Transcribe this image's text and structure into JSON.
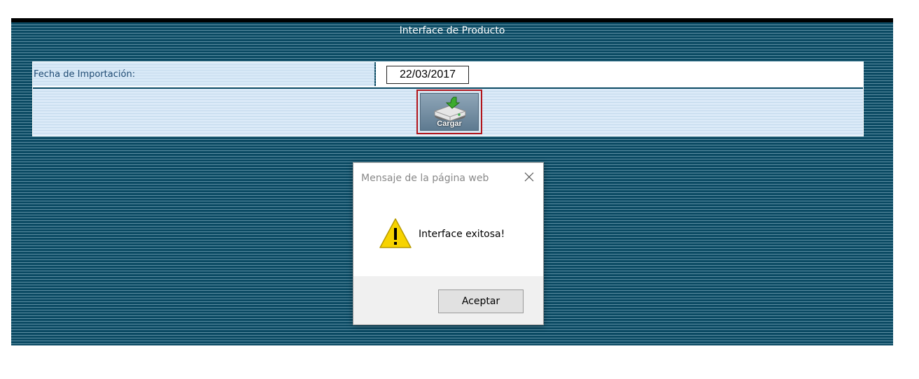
{
  "page": {
    "title": "Interface de Producto"
  },
  "form": {
    "date_label": "Fecha de Importación:",
    "date_value": "22/03/2017",
    "load_button_label": "Cargar",
    "load_button_icon": "disk-download-icon"
  },
  "dialog": {
    "title": "Mensaje de la página web",
    "message": "Interface exitosa!",
    "ok_label": "Aceptar",
    "icon": "warning-icon",
    "close_icon": "close-icon"
  },
  "colors": {
    "panel_background": "#0c4a63",
    "form_background": "#dbeaf8",
    "label_text": "#1f4b73",
    "highlight_border": "#b2151c",
    "warning_yellow": "#f7d300"
  }
}
